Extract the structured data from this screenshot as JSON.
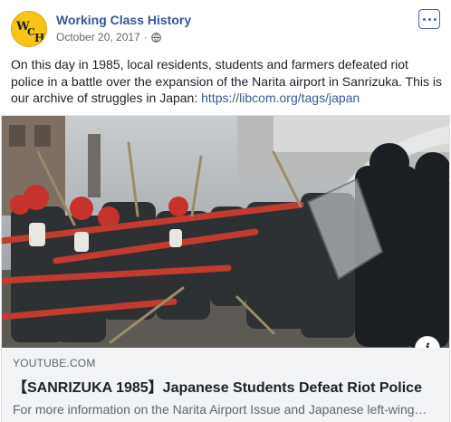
{
  "post": {
    "page_name": "Working Class History",
    "date": "October 20, 2017",
    "separator": "·",
    "privacy_icon": "globe-icon",
    "more_icon": "more-options-icon",
    "avatar_text": "WCH",
    "text": "On this day in 1985, local residents, students and farmers defeated riot police in a battle over the expansion of the Narita airport in Sanrizuka. This is our archive of struggles in Japan: ",
    "link_url": "https://libcom.org/tags/japan"
  },
  "link_card": {
    "domain": "YOUTUBE.COM",
    "title": "【SANRIZUKA 1985】Japanese Students Defeat Riot Police",
    "description": "For more information on the Narita Airport Issue and Japanese left-wing…",
    "info_icon_label": "i"
  },
  "colors": {
    "link": "#365899",
    "avatar": "#f7c518",
    "card_bg": "#f2f3f5"
  }
}
